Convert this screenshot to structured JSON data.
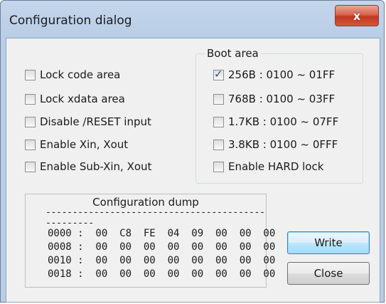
{
  "window": {
    "title": "Configuration dialog",
    "close_glyph": "x"
  },
  "options": [
    {
      "label": "Lock code area",
      "checked": false
    },
    {
      "label": "Lock xdata area",
      "checked": false
    },
    {
      "label": "Disable /RESET input",
      "checked": false
    },
    {
      "label": "Enable Xin, Xout",
      "checked": false
    },
    {
      "label": "Enable Sub-Xin, Xout",
      "checked": false
    }
  ],
  "boot_area": {
    "title": "Boot area",
    "items": [
      {
        "label": "256B : 0100 ~ 01FF",
        "checked": true
      },
      {
        "label": "768B : 0100 ~ 03FF",
        "checked": false
      },
      {
        "label": "1.7KB : 0100 ~ 07FF",
        "checked": false
      },
      {
        "label": "3.8KB : 0100 ~ 0FFF",
        "checked": false
      },
      {
        "label": "Enable HARD lock",
        "checked": false
      }
    ]
  },
  "dump": {
    "title": "Configuration dump",
    "separator": "--------------------------------------------------",
    "lines": [
      "0000 :  00  C8  FE  04  09  00  00  00",
      "0008 :  00  00  00  00  00  00  00  00",
      "0010 :  00  00  00  00  00  00  00  00",
      "0018 :  00  00  00  00  00  00  00  00"
    ]
  },
  "buttons": {
    "write": "Write",
    "close": "Close"
  },
  "check_glyph": "✓"
}
